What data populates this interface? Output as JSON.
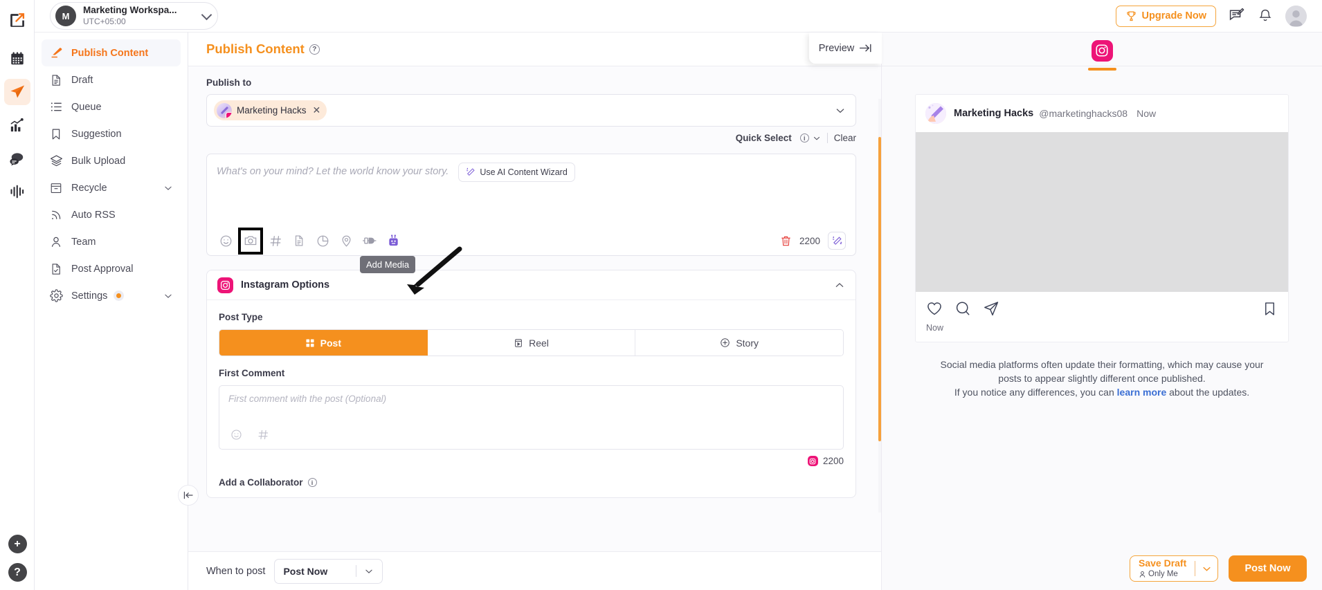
{
  "rail": {
    "logo": "app-logo",
    "items": [
      {
        "name": "calendar",
        "active": false
      },
      {
        "name": "publish",
        "active": true
      },
      {
        "name": "analytics",
        "active": false
      },
      {
        "name": "inbox",
        "active": false
      },
      {
        "name": "reports",
        "active": false
      }
    ],
    "bottom": [
      {
        "name": "add",
        "label": "+"
      },
      {
        "name": "help",
        "label": "?"
      }
    ]
  },
  "header": {
    "workspace_initial": "M",
    "workspace_name": "Marketing Workspa...",
    "workspace_timezone": "UTC+05:00",
    "upgrade_label": "Upgrade Now",
    "icons": [
      "trophy-icon",
      "feedback-icon",
      "notification-bell-icon",
      "user-avatar"
    ]
  },
  "sidebar": {
    "items": [
      {
        "label": "Publish Content",
        "icon": "pencil-icon",
        "active": true,
        "chevron": false,
        "badge": false
      },
      {
        "label": "Draft",
        "icon": "document-icon",
        "active": false,
        "chevron": false,
        "badge": false
      },
      {
        "label": "Queue",
        "icon": "list-icon",
        "active": false,
        "chevron": false,
        "badge": false
      },
      {
        "label": "Suggestion",
        "icon": "bookmark-icon",
        "active": false,
        "chevron": false,
        "badge": false
      },
      {
        "label": "Bulk Upload",
        "icon": "layers-icon",
        "active": false,
        "chevron": false,
        "badge": false
      },
      {
        "label": "Recycle",
        "icon": "archive-icon",
        "active": false,
        "chevron": true,
        "badge": false
      },
      {
        "label": "Auto RSS",
        "icon": "rss-icon",
        "active": false,
        "chevron": false,
        "badge": false
      },
      {
        "label": "Team",
        "icon": "person-icon",
        "active": false,
        "chevron": false,
        "badge": false
      },
      {
        "label": "Post Approval",
        "icon": "document-check-icon",
        "active": false,
        "chevron": false,
        "badge": false
      },
      {
        "label": "Settings",
        "icon": "gear-icon",
        "active": false,
        "chevron": true,
        "badge": true
      }
    ]
  },
  "content": {
    "page_title": "Publish Content",
    "publish_to_label": "Publish to",
    "account_chip": {
      "name": "Marketing Hacks",
      "remove": "✕"
    },
    "quick_select_label": "Quick Select",
    "clear_label": "Clear",
    "composer": {
      "placeholder": "What's on your mind? Let the world know your story.",
      "ai_wizard_label": "Use AI Content Wizard",
      "char_count": "2200",
      "tools": [
        "emoji-icon",
        "add-media-icon",
        "hashtag-icon",
        "document-icon",
        "chart-icon",
        "location-pin-icon",
        "plug-icon",
        "robot-icon"
      ],
      "tooltip": "Add Media"
    },
    "instagram_options": {
      "title": "Instagram Options",
      "post_type_label": "Post Type",
      "post_types": [
        {
          "label": "Post",
          "icon": "grid-icon",
          "selected": true
        },
        {
          "label": "Reel",
          "icon": "reel-icon",
          "selected": false
        },
        {
          "label": "Story",
          "icon": "plus-circle-icon",
          "selected": false
        }
      ],
      "first_comment_label": "First Comment",
      "first_comment_placeholder": "First comment with the post (Optional)",
      "first_comment_count": "2200",
      "collaborator_label": "Add a Collaborator"
    },
    "footer": {
      "when_to_post_label": "When to post",
      "when_to_post_value": "Post Now"
    }
  },
  "preview": {
    "button_label": "Preview",
    "active_platform": "instagram",
    "card": {
      "account_name": "Marketing Hacks",
      "handle": "@marketinghacks08",
      "time": "Now",
      "footer_time": "Now",
      "actions": [
        "heart-icon",
        "comment-icon",
        "share-icon",
        "bookmark-icon"
      ]
    },
    "disclaimer_line1": "Social media platforms often update their formatting, which may cause your",
    "disclaimer_line2": "posts to appear slightly different once published.",
    "disclaimer_line3_a": "If you notice any differences, you can ",
    "disclaimer_link": "learn more",
    "disclaimer_line3_b": " about the updates."
  },
  "actions": {
    "save_draft_label": "Save Draft",
    "save_draft_sub": "Only Me",
    "post_now_label": "Post Now"
  },
  "colors": {
    "accent_orange": "#f5901e",
    "instagram_pink": "#ed1477",
    "link_blue": "#3b6fd4"
  }
}
